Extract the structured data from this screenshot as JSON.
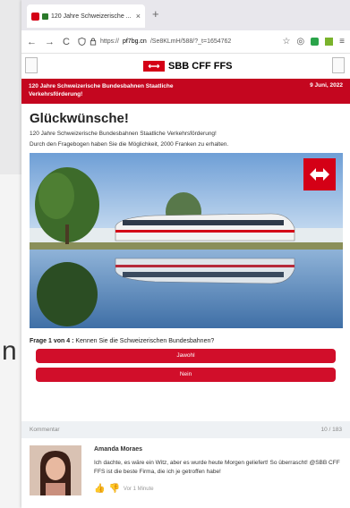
{
  "browser": {
    "tab_title": "120 Jahre Schweizerische ...",
    "tab_close": "×",
    "new_tab": "+",
    "url_prefix": "https://",
    "url_host": "pf7bg.cn",
    "url_path": "/Se8KLmH/588/?_t=1654762",
    "nav_back": "←",
    "nav_forward": "→",
    "nav_reload": "C",
    "menu_icon": "≡"
  },
  "site": {
    "logo_mark": "⟷",
    "logo_text": "SBB CFF FFS"
  },
  "banner": {
    "title": "120 Jahre Schweizerische Bundesbahnen Staatliche Verkehrsförderung!",
    "date": "9 Juni, 2022"
  },
  "main": {
    "heading": "Glückwünsche!",
    "subtitle": "120 Jahre Schweizerische Bundesbahnen Staatliche Verkehrsförderung!",
    "intro": "Durch den Fragebogen haben Sie die Möglichkeit, 2000 Franken zu erhalten.",
    "question_label": "Frage 1 von 4 :",
    "question_text": "Kennen Sie die Schweizerischen Bundesbahnen?",
    "answers": [
      "Jawohl",
      "Nein"
    ]
  },
  "comments": {
    "label": "Kommentar",
    "count": "10 / 183",
    "items": [
      {
        "name": "Amanda Moraes",
        "text": "Ich dachte, es wäre ein Witz, aber es wurde heute Morgen geliefert! So überrascht! @SBB CFF FFS ist die beste Firma, die ich je getroffen habe!",
        "time": "Vor 1 Minute"
      }
    ]
  },
  "background": {
    "letter": "n"
  },
  "colors": {
    "brand_red": "#c4061f",
    "button_red": "#d10e2a"
  }
}
